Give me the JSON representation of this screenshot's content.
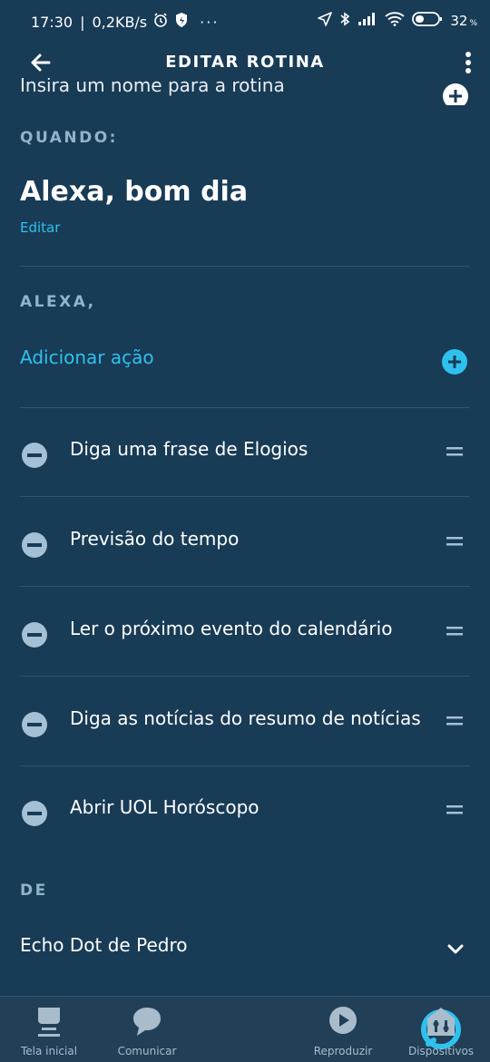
{
  "status_bar": {
    "time": "17:30",
    "data_rate": "0,2KB/s",
    "more": "···",
    "battery": "32",
    "battery_unit": "%",
    "battery_level": 0.32
  },
  "header": {
    "title": "EDITAR ROTINA"
  },
  "routine_name": {
    "placeholder": "Insira um nome para a rotina"
  },
  "when": {
    "label": "QUANDO:",
    "trigger": "Alexa, bom dia",
    "edit_label": "Editar"
  },
  "alexa": {
    "label": "ALEXA,",
    "add_action": "Adicionar ação",
    "actions": [
      {
        "label": "Diga uma frase de Elogios"
      },
      {
        "label": "Previsão do tempo"
      },
      {
        "label": "Ler o próximo evento do calendário"
      },
      {
        "label": "Diga as notícias do resumo de notícias"
      },
      {
        "label": "Abrir UOL Horóscopo"
      }
    ]
  },
  "from": {
    "label": "DE",
    "device": "Echo Dot de Pedro"
  },
  "bottom_nav": {
    "home": "Tela inicial",
    "communicate": "Comunicar",
    "play": "Reproduzir",
    "devices": "Dispositivos"
  },
  "colors": {
    "background": "#183b56",
    "accent": "#2fc1ee",
    "section_label": "#92b3c9",
    "minus_icon": "#a3c0d5",
    "divider": "#2f5672",
    "nav_background": "#213f57"
  }
}
